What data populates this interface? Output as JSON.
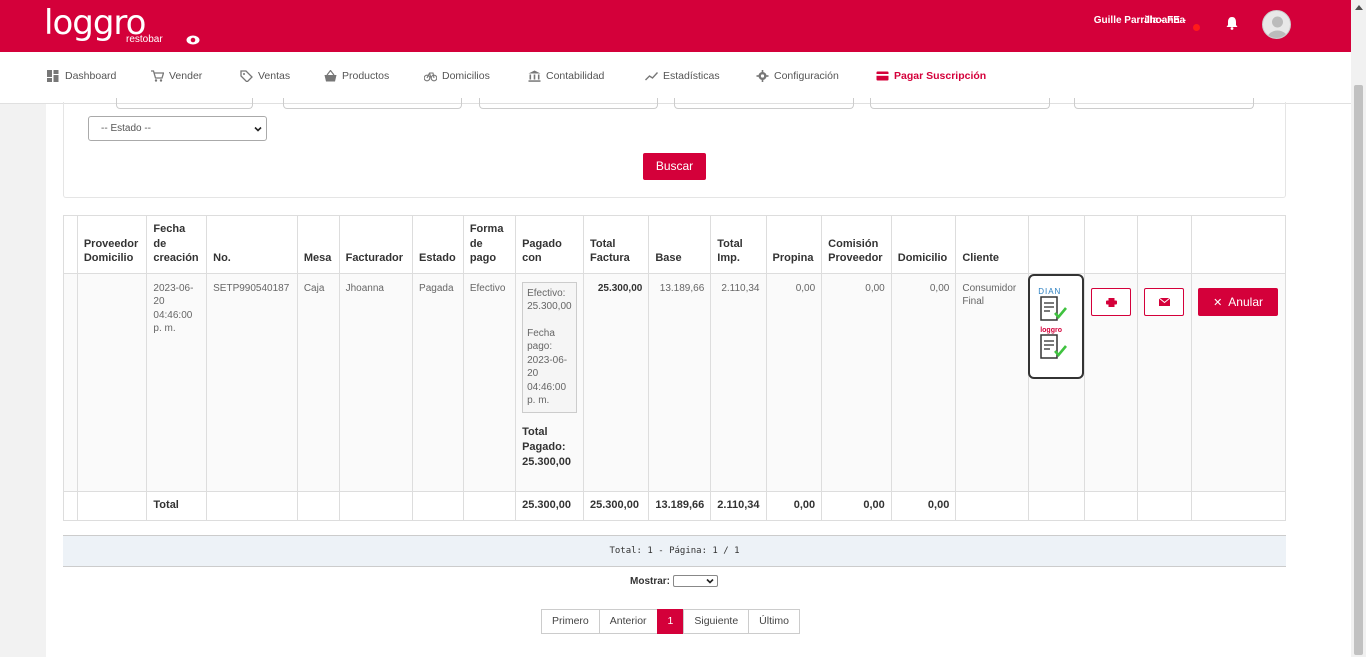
{
  "brand": {
    "logo_text": "loggro",
    "logo_sub": "restobar"
  },
  "header": {
    "company": "Guille Parrilla - FE -",
    "user": "Jhoanna"
  },
  "nav": {
    "items": [
      {
        "label": "Dashboard",
        "icon": "dashboard-icon"
      },
      {
        "label": "Vender",
        "icon": "cart-icon"
      },
      {
        "label": "Ventas",
        "icon": "tag-icon"
      },
      {
        "label": "Productos",
        "icon": "basket-icon"
      },
      {
        "label": "Domicilios",
        "icon": "bicycle-icon"
      },
      {
        "label": "Contabilidad",
        "icon": "bank-icon"
      },
      {
        "label": "Estadísticas",
        "icon": "chart-icon"
      },
      {
        "label": "Configuración",
        "icon": "gear-icon"
      },
      {
        "label": "Pagar Suscripción",
        "icon": "card-icon"
      }
    ]
  },
  "filters": {
    "estado_placeholder": "-- Estado --",
    "buscar_label": "Buscar"
  },
  "table": {
    "headers": [
      "",
      "Proveedor Domicilio",
      "Fecha de creación",
      "No.",
      "Mesa",
      "Facturador",
      "Estado",
      "Forma de pago",
      "Pagado con",
      "Total Factura",
      "Base",
      "Total Imp.",
      "Propina",
      "Comisión Proveedor",
      "Domicilio",
      "Cliente",
      "",
      "",
      "",
      ""
    ],
    "row": {
      "fecha": "2023-06-20 04:46:00 p. m.",
      "numero": "SETP990540187",
      "mesa": "Caja",
      "facturador": "Jhoanna",
      "estado": "Pagada",
      "forma_pago": "Efectivo",
      "pagado_efectivo": "Efectivo: 25.300,00",
      "pagado_fecha_label": "Fecha pago:",
      "pagado_fecha": "2023-06-20 04:46:00 p. m.",
      "pagado_total_label": "Total Pagado:",
      "pagado_total": "25.300,00",
      "total_factura": "25.300,00",
      "base": "13.189,66",
      "total_imp": "2.110,34",
      "propina": "0,00",
      "comision": "0,00",
      "domicilio": "0,00",
      "cliente": "Consumidor Final",
      "dian_label": "DIAN",
      "loggro_label": "loggro",
      "anular_label": "Anular"
    },
    "totals": {
      "label": "Total",
      "pagado": "25.300,00",
      "total_factura": "25.300,00",
      "base": "13.189,66",
      "total_imp": "2.110,34",
      "propina": "0,00",
      "comision": "0,00",
      "domicilio": "0,00"
    }
  },
  "pager": {
    "summary": "Total: 1 - Página: 1 / 1",
    "mostrar_label": "Mostrar:",
    "buttons": [
      "Primero",
      "Anterior",
      "1",
      "Siguiente",
      "Último"
    ]
  },
  "colors": {
    "brand": "#d4003a",
    "check": "#3fc23f"
  }
}
